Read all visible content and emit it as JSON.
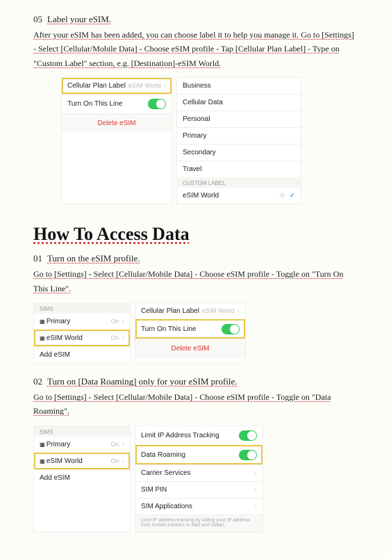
{
  "step05": {
    "num": "05",
    "title": "Label your eSIM.",
    "body": "After your eSIM has been added, you can choose label it to help you manage it. Go to [Settings] - Select [Cellular/Mobile Data] - Choose eSIM profile - Tap [Cellular Plan Label] - Type on \"Custom Label\" section, e.g. [Destination]-eSIM World."
  },
  "mock05_left": {
    "row1_label": "Cellular Plan Label",
    "row1_val": "eSIM World",
    "row2_label": "Turn On This Line",
    "delete": "Delete eSIM"
  },
  "mock05_right": {
    "items": [
      "Business",
      "Cellular Data",
      "Personal",
      "Primary",
      "Secondary",
      "Travel"
    ],
    "custom_head": "CUSTOM LABEL",
    "custom_value": "eSIM World"
  },
  "heading_access": "How To Access Data",
  "stepA1": {
    "num": "01",
    "title": "Turn on the eSIM profile.",
    "body": "Go to [Settings] - Select [Cellular/Mobile Data] - Choose eSIM profile - Toggle on \"Turn On This Line\"."
  },
  "mockA1_left": {
    "head": "SIMs",
    "primary": "Primary",
    "primary_val": "On",
    "esim": "eSIM World",
    "esim_val": "On",
    "add": "Add eSIM"
  },
  "mockA1_right": {
    "row1_label": "Cellular Plan Label",
    "row1_val": "eSIM World",
    "row2_label": "Turn On This Line",
    "delete": "Delete eSIM"
  },
  "stepA2": {
    "num": "02",
    "title": "Turn on [Data Roaming] only for your eSIM profile.",
    "body": "Go to [Settings] - Select [Cellular/Mobile Data] - Choose eSIM profile - Toggle on \"Data Roaming\"."
  },
  "mockA2_left": {
    "head": "SIMs",
    "primary": "Primary",
    "primary_val": "On",
    "esim": "eSIM World",
    "esim_val": "On",
    "add": "Add eSIM"
  },
  "mockA2_right": {
    "r1": "Limit IP Address Tracking",
    "r2": "Data Roaming",
    "r3": "Carrier Services",
    "r4": "SIM PIN",
    "r5": "SIM Applications",
    "foot": "Limit IP address tracking by hiding your IP address from known trackers in Mail and Safari."
  }
}
